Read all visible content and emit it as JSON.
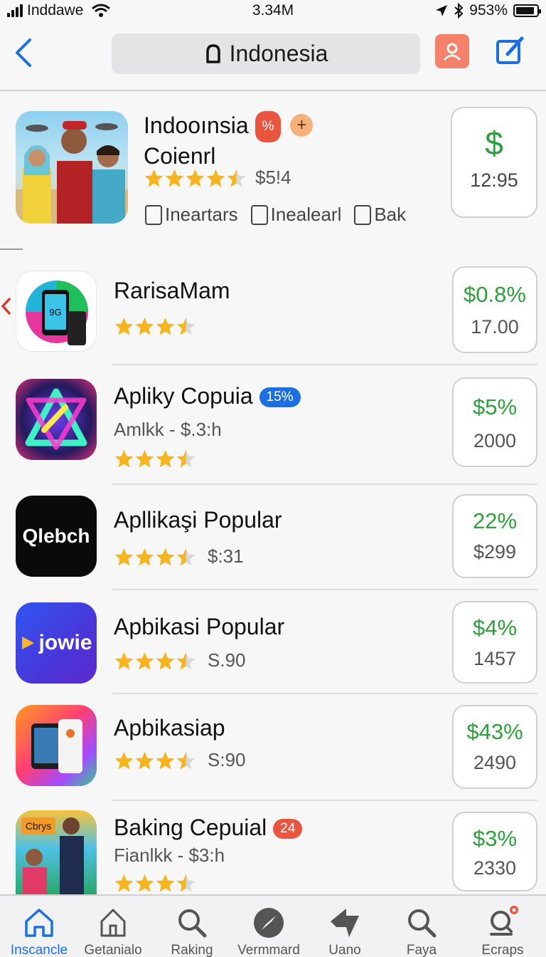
{
  "status_bar": {
    "carrier": "Inddawe",
    "time": "3.34M",
    "battery": "953%"
  },
  "nav": {
    "search_text": "Indonesia"
  },
  "featured": {
    "title_line1": "Indooınsia",
    "title_line2": "Coienrl",
    "badge": "%",
    "plus": "+",
    "rating": 4.5,
    "price_text": "$5!4",
    "tags": [
      "Ineartars",
      "Inealearl",
      "Bak"
    ],
    "price_box": {
      "top": "$",
      "bottom": "12:95"
    }
  },
  "apps": [
    {
      "name": "RarisaMam",
      "badge": "",
      "subtitle": "",
      "rating": 3.5,
      "extra": "",
      "price_top": "$0.8%",
      "price_bottom": "17.00",
      "icon": "phone-icon"
    },
    {
      "name": "Apliky Copuia",
      "badge": "15%",
      "subtitle": "Amlkk - $.3:h",
      "rating": 3.5,
      "extra": "",
      "price_top": "$5%",
      "price_bottom": "2000",
      "icon": "neon-triangle-icon"
    },
    {
      "name": "Apllikaşi Popular",
      "badge": "",
      "subtitle": "",
      "rating": 3.5,
      "extra": "$:31",
      "price_top": "22%",
      "price_bottom": "$299",
      "icon_text": "Qlebch",
      "icon": "qlebch-logo-icon"
    },
    {
      "name": "Apbikasi Popular",
      "badge": "",
      "subtitle": "",
      "rating": 3.5,
      "extra": "S.90",
      "price_top": "$4%",
      "price_bottom": "1457",
      "icon_text": "jowie",
      "icon": "play-logo-icon"
    },
    {
      "name": "Apbikasiap",
      "badge": "",
      "subtitle": "",
      "rating": 3.5,
      "extra": "S:90",
      "price_top": "$43%",
      "price_bottom": "2490",
      "icon": "tablet-icon"
    },
    {
      "name": "Baking Cepuial",
      "badge": "24",
      "subtitle": "Fianlkk - $3:h",
      "rating": 3.5,
      "extra": "",
      "price_top": "$3%",
      "price_bottom": "2330",
      "icon_text": "Cbrys",
      "icon": "photo-people-icon"
    }
  ],
  "tabs": [
    {
      "label": "Inscancle",
      "icon": "home-icon",
      "active": true
    },
    {
      "label": "Getanialo",
      "icon": "house-outline-icon",
      "active": false
    },
    {
      "label": "Raking",
      "icon": "search-icon",
      "active": false
    },
    {
      "label": "Vermmard",
      "icon": "compass-icon",
      "active": false
    },
    {
      "label": "Uano",
      "icon": "arrow-icon",
      "active": false
    },
    {
      "label": "Faya",
      "icon": "search-icon",
      "active": false
    },
    {
      "label": "Ecraps",
      "icon": "notification-search-icon",
      "active": false
    }
  ],
  "colors": {
    "accent": "#1b6fe0",
    "price_green": "#2f9e3e",
    "badge_red": "#e9553e",
    "star": "#f6b51e"
  }
}
